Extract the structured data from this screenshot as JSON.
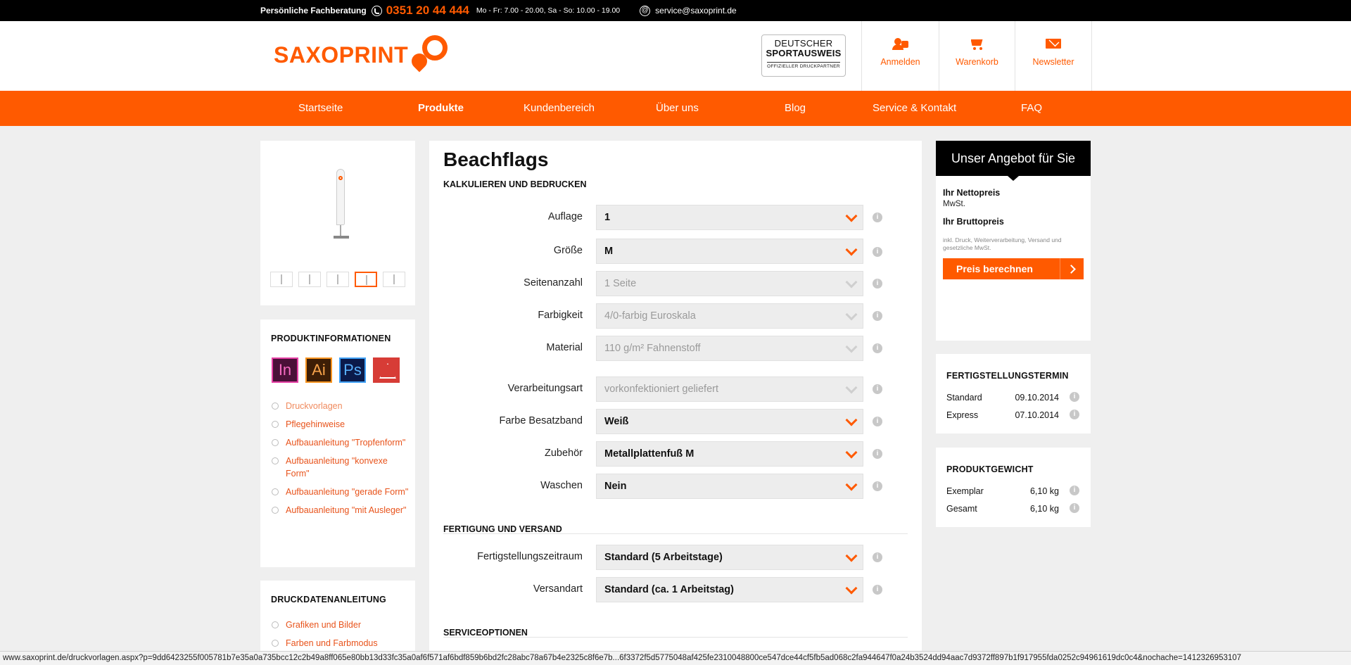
{
  "topbar": {
    "consult": "Persönliche Fachberatung",
    "phone": "0351 20 44 444",
    "hours": "Mo - Fr: 7.00 - 20.00, Sa - So: 10.00 - 19.00",
    "email": "service@saxoprint.de"
  },
  "header": {
    "logo_a": "SAXO",
    "logo_b": "PRINT",
    "badge": {
      "l1": "DEUTSCHER",
      "l2": "SPORTAUSWEIS",
      "l3": "OFFIZIELLER DRUCKPARTNER"
    },
    "buttons": {
      "login": "Anmelden",
      "cart": "Warenkorb",
      "newsletter": "Newsletter"
    }
  },
  "nav": {
    "items": [
      "Startseite",
      "Produkte",
      "Kundenbereich",
      "Über uns",
      "Blog",
      "Service & Kontakt",
      "FAQ"
    ],
    "active": "Produkte"
  },
  "left": {
    "info_title": "PRODUKTINFORMATIONEN",
    "software": [
      "In",
      "Ai",
      "Ps"
    ],
    "links": [
      "Druckvorlagen",
      "Pflegehinweise",
      "Aufbauanleitung \"Tropfenform\"",
      "Aufbauanleitung \"konvexe Form\"",
      "Aufbauanleitung \"gerade Form\"",
      "Aufbauanleitung \"mit Ausleger\""
    ],
    "druck_title": "DRUCKDATENANLEITUNG",
    "druck_links": [
      "Grafiken und Bilder",
      "Farben und Farbmodus"
    ]
  },
  "main": {
    "title": "Beachflags",
    "section1": "KALKULIEREN UND BEDRUCKEN",
    "rows": [
      {
        "label": "Auflage",
        "value": "1"
      },
      {
        "label": "Größe",
        "value": "M"
      },
      {
        "label": "Seitenanzahl",
        "value": "1 Seite"
      },
      {
        "label": "Farbigkeit",
        "value": "4/0-farbig Euroskala"
      },
      {
        "label": "Material",
        "value": "110 g/m² Fahnenstoff"
      },
      {
        "label": "Verarbeitungsart",
        "value": "vorkonfektioniert geliefert"
      },
      {
        "label": "Farbe Besatzband",
        "value": "Weiß"
      },
      {
        "label": "Zubehör",
        "value": "Metallplattenfuß M"
      },
      {
        "label": "Waschen",
        "value": "Nein"
      }
    ],
    "section2": "FERTIGUNG UND VERSAND",
    "rows2": [
      {
        "label": "Fertigstellungszeitraum",
        "value": "Standard (5 Arbeitstage)"
      },
      {
        "label": "Versandart",
        "value": "Standard (ca. 1 Arbeitstag)"
      }
    ],
    "section3": "SERVICEOPTIONEN",
    "info_glyph": "i"
  },
  "offer": {
    "title": "Unser Angebot für Sie",
    "net": "Ihr Nettopreis",
    "mwst": "MwSt.",
    "gross": "Ihr Bruttopreis",
    "note": "inkl. Druck, Weiterverarbeitung, Versand und gesetzliche MwSt.",
    "button": "Preis berechnen"
  },
  "deadline": {
    "title": "FERTIGSTELLUNGSTERMIN",
    "rows": [
      {
        "k": "Standard",
        "v": "09.10.2014"
      },
      {
        "k": "Express",
        "v": "07.10.2014"
      }
    ]
  },
  "weight": {
    "title": "PRODUKTGEWICHT",
    "rows": [
      {
        "k": "Exemplar",
        "v": "6,10 kg"
      },
      {
        "k": "Gesamt",
        "v": "6,10 kg"
      }
    ]
  },
  "status_url": "www.saxoprint.de/druckvorlagen.aspx?p=9dd6423255f005781b7e35a0a735bcc12c2b49a8ff065e80bb13d33fc35a0af6f571af6bdf859b6bd2fc28abc78a67b4e2325c8f6e7b...6f3372f5d5775048af425fe2310048800ce547dce44cf5fb5ad068c2fa944647f0a24b3524dd94aac7d9372ff897b1f917955fda0252c94961619dc0c4&nochache=1412326953107"
}
